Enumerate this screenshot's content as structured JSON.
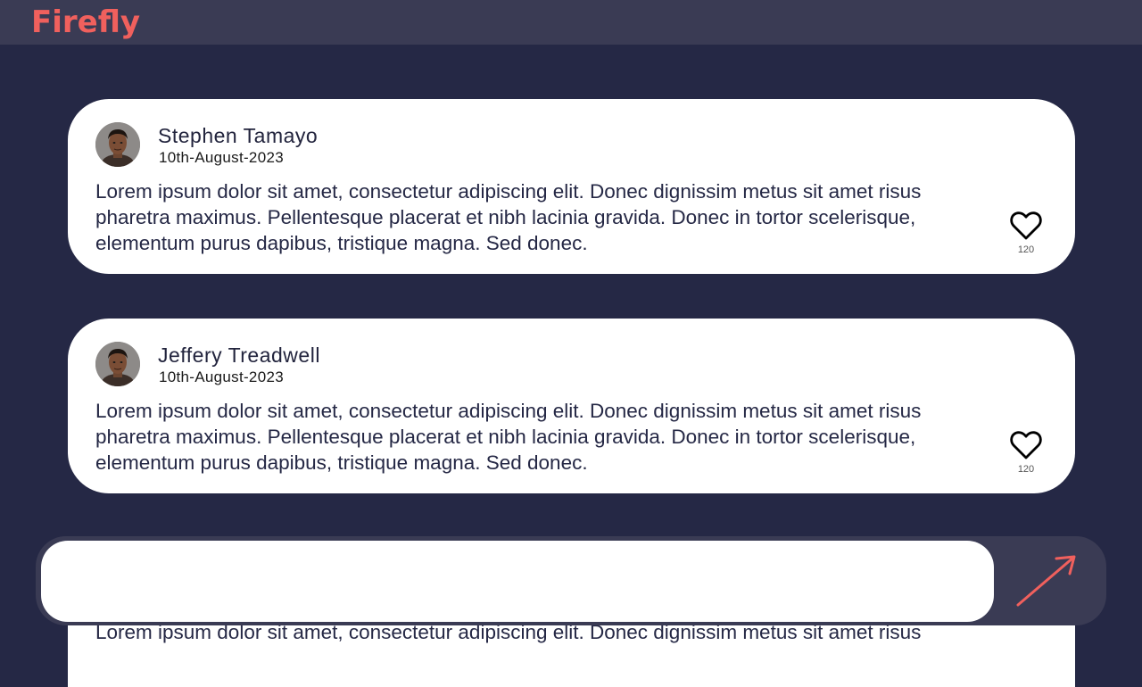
{
  "app": {
    "brand": "Firefly"
  },
  "posts": [
    {
      "author": "Stephen Tamayo",
      "date": "10th-August-2023",
      "text": "Lorem ipsum dolor sit amet, consectetur adipiscing elit. Donec dignissim metus sit amet risus pharetra maximus. Pellentesque placerat et nibh lacinia gravida. Donec in tortor scelerisque, elementum purus dapibus, tristique magna. Sed donec.",
      "likes": "120"
    },
    {
      "author": "Jeffery Treadwell",
      "date": "10th-August-2023",
      "text": "Lorem ipsum dolor sit amet, consectetur adipiscing elit. Donec dignissim metus sit amet risus pharetra maximus. Pellentesque placerat et nibh lacinia gravida. Donec in tortor scelerisque, elementum purus dapibus, tristique magna. Sed donec.",
      "likes": "120"
    },
    {
      "text": "Lorem ipsum dolor sit amet, consectetur adipiscing elit. Donec dignissim metus sit amet risus"
    }
  ],
  "composer": {
    "value": "",
    "placeholder": ""
  },
  "icons": {
    "like": "heart-outline-icon",
    "send": "arrow-up-right-icon",
    "avatar": "user-photo"
  },
  "colors": {
    "background": "#252845",
    "topbar": "#3a3b54",
    "brand": "#f0605d",
    "card": "#ffffff",
    "send_arrow": "#f0605d"
  }
}
